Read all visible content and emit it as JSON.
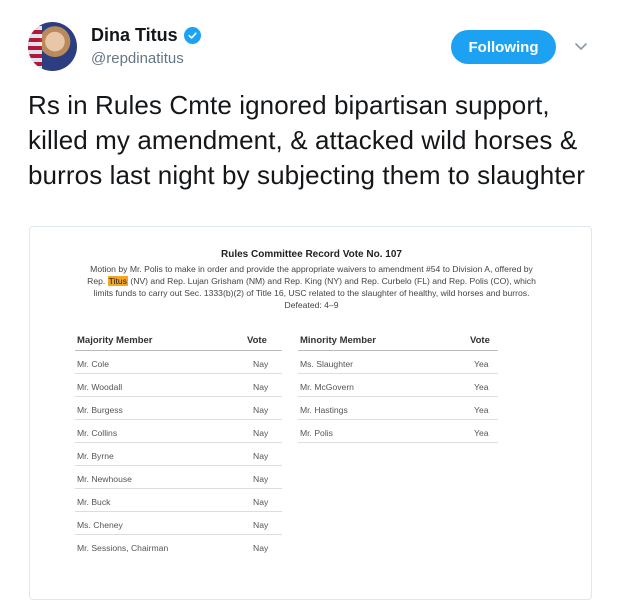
{
  "user": {
    "name": "Dina Titus",
    "handle": "@repdinatitus",
    "verified": true
  },
  "follow_button": {
    "label": "Following",
    "color": "#1da1f2"
  },
  "tweet": {
    "text": "Rs in Rules Cmte ignored bipartisan support, killed my amendment, & attacked wild horses & burros last night by subjecting them to slaughter"
  },
  "document": {
    "title": "Rules Committee Record Vote No. 107",
    "description_before": "Motion by Mr. Polis to make in order and provide the appropriate waivers to amendment #54 to Division A, offered by Rep. ",
    "description_highlight": "Titus",
    "description_after": " (NV) and Rep. Lujan Grisham (NM) and Rep. King (NY) and Rep. Curbelo (FL) and Rep. Polis (CO), which limits funds to carry out Sec. 1333(b)(2) of Title 16, USC related to the slaughter of healthy, wild horses and burros. Defeated: 4–9",
    "highlight_color": "#f5a623",
    "majority": {
      "header_member": "Majority Member",
      "header_vote": "Vote",
      "rows": [
        {
          "member": "Mr. Cole",
          "vote": "Nay"
        },
        {
          "member": "Mr. Woodall",
          "vote": "Nay"
        },
        {
          "member": "Mr. Burgess",
          "vote": "Nay"
        },
        {
          "member": "Mr. Collins",
          "vote": "Nay"
        },
        {
          "member": "Mr. Byrne",
          "vote": "Nay"
        },
        {
          "member": "Mr. Newhouse",
          "vote": "Nay"
        },
        {
          "member": "Mr. Buck",
          "vote": "Nay"
        },
        {
          "member": "Ms. Cheney",
          "vote": "Nay"
        },
        {
          "member": "Mr. Sessions, Chairman",
          "vote": "Nay"
        }
      ]
    },
    "minority": {
      "header_member": "Minority Member",
      "header_vote": "Vote",
      "rows": [
        {
          "member": "Ms. Slaughter",
          "vote": "Yea"
        },
        {
          "member": "Mr. McGovern",
          "vote": "Yea"
        },
        {
          "member": "Mr. Hastings",
          "vote": "Yea"
        },
        {
          "member": "Mr. Polis",
          "vote": "Yea"
        }
      ]
    }
  },
  "icons": {
    "verified": "verified-badge-icon",
    "caret": "chevron-down-icon"
  }
}
